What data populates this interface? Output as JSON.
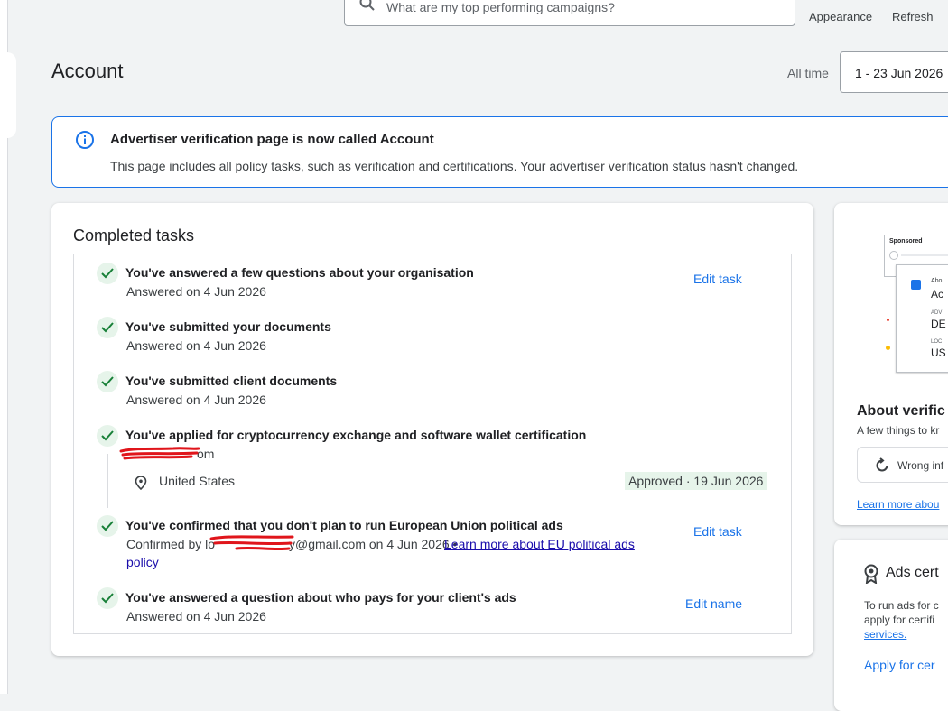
{
  "topbar": {
    "search_placeholder": "What are my top performing campaigns?",
    "appearance": "Appearance",
    "refresh": "Refresh"
  },
  "header": {
    "title": "Account",
    "range_label": "All time",
    "date_range": "1 - 23 Jun 2026"
  },
  "banner": {
    "title": "Advertiser verification page is now called Account",
    "text": "This page includes all policy tasks, such as verification and certifications. Your advertiser verification status hasn't changed."
  },
  "completed": {
    "title": "Completed tasks",
    "tasks": [
      {
        "title": "You've answered a few questions about your organisation",
        "sub": "Answered on 4 Jun 2026",
        "action": "Edit task"
      },
      {
        "title": "You've submitted your documents",
        "sub": "Answered on 4 Jun 2026"
      },
      {
        "title": "You've submitted client documents",
        "sub": "Answered on 4 Jun 2026"
      },
      {
        "title": "You've applied for cryptocurrency exchange and software wallet certification",
        "sub_suffix": "om",
        "location": "United States",
        "status": "Approved · 19 Jun 2026"
      },
      {
        "title": "You've confirmed that you don't plan to run European Union political ads",
        "sub_prefix": "Confirmed by lo",
        "sub_middle": "y@gmail.com on 4 Jun 2026 •",
        "link1": "Learn more about EU political ads",
        "link2": "policy",
        "action": "Edit task"
      },
      {
        "title": "You've answered a question about who pays for your client's ads",
        "sub": "Answered on 4 Jun 2026",
        "action": "Edit name"
      }
    ]
  },
  "about_card": {
    "sponsored": "Sponsored",
    "ad_line1": "Abo",
    "ad_line2": "Ac",
    "ad_label1": "ADV",
    "ad_value1": "DE",
    "ad_label2": "LOC",
    "ad_value2": "US",
    "title": "About verific",
    "subtitle": "A few things to kr",
    "chip": "Wrong inf",
    "link": "Learn more abou"
  },
  "ads_cert_card": {
    "title": "Ads cert",
    "text1": "To run ads for c",
    "text2": "apply for certifi",
    "link": "services.",
    "action": "Apply for cer"
  },
  "colors": {
    "accent": "#1a73e8",
    "success_bg": "#e6f4ea",
    "success": "#188038",
    "redaction": "#e0151b"
  }
}
